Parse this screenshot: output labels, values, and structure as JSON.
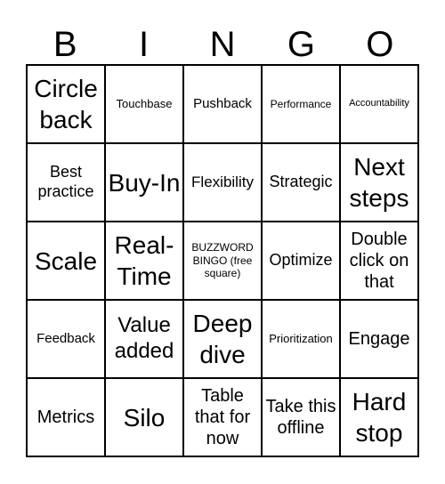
{
  "header": [
    "B",
    "I",
    "N",
    "G",
    "O"
  ],
  "cells": [
    "Circle back",
    "Touchbase",
    "Pushback",
    "Performance",
    "Accountability",
    "Best practice",
    "Buy-In",
    "Flexibility",
    "Strategic",
    "Next steps",
    "Scale",
    "Real-Time",
    "BUZZWORD BINGO (free square)",
    "Optimize",
    "Double click on that",
    "Feedback",
    "Value added",
    "Deep dive",
    "Prioritization",
    "Engage",
    "Metrics",
    "Silo",
    "Table that for now",
    "Take this offline",
    "Hard stop"
  ]
}
